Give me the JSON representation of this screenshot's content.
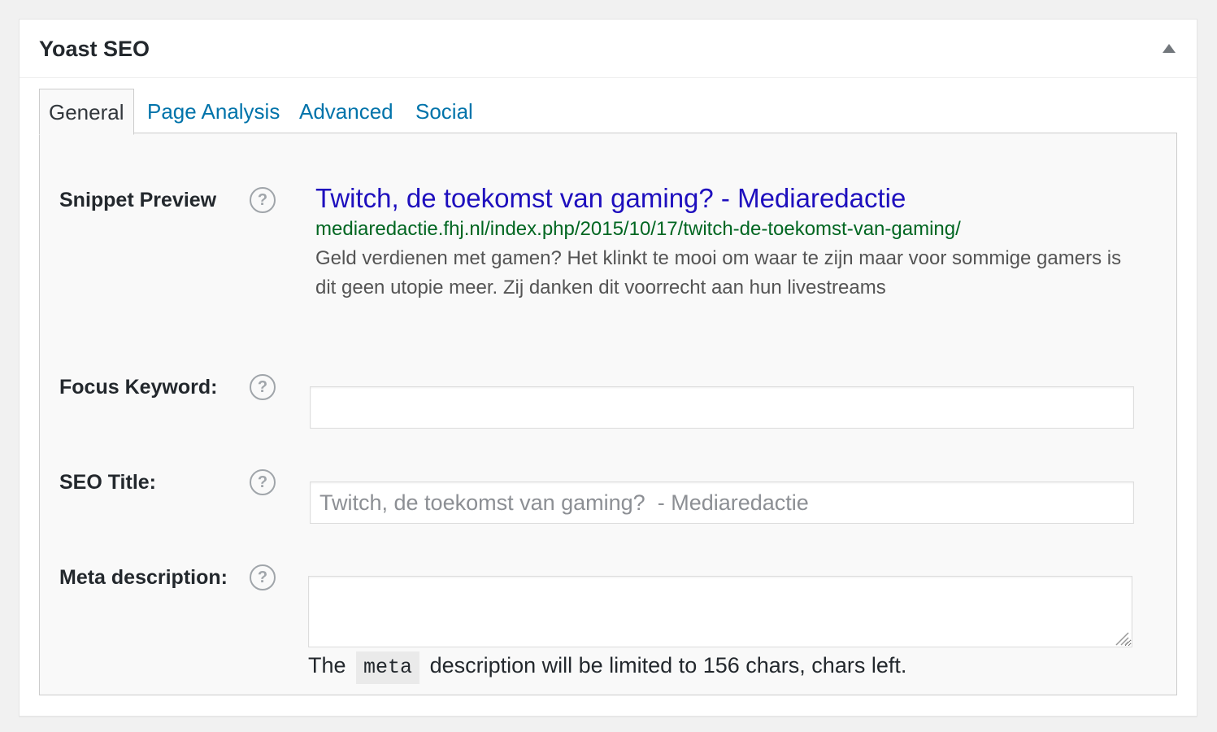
{
  "metabox": {
    "title": "Yoast SEO",
    "toggle_icon": "arrow-up-icon"
  },
  "tabs": [
    {
      "label": "General",
      "active": true
    },
    {
      "label": "Page Analysis",
      "active": false
    },
    {
      "label": "Advanced",
      "active": false
    },
    {
      "label": "Social",
      "active": false
    }
  ],
  "snippet_preview": {
    "label": "Snippet Preview",
    "title": "Twitch, de toekomst van gaming? - Mediaredactie",
    "url": "mediaredactie.fhj.nl/index.php/2015/10/17/twitch-de-toekomst-van-gaming/",
    "description": "Geld verdienen met gamen? Het klinkt te mooi om waar te zijn maar voor sommige gamers is dit geen utopie meer. Zij danken dit voorrecht aan hun livestreams"
  },
  "focus_keyword": {
    "label": "Focus Keyword:",
    "value": ""
  },
  "seo_title": {
    "label": "SEO Title:",
    "value": "",
    "placeholder": "Twitch, de toekomst van gaming?  - Mediaredactie"
  },
  "meta_description": {
    "label": "Meta description:",
    "value": "",
    "note_before": "The",
    "note_code": "meta",
    "note_after": "description will be limited to 156 chars, chars left."
  },
  "help_icon_glyph": "?",
  "colors": {
    "link": "#0073aa",
    "snippet_title": "#1e0fbe",
    "snippet_url": "#006621",
    "snippet_desc": "#545454"
  }
}
